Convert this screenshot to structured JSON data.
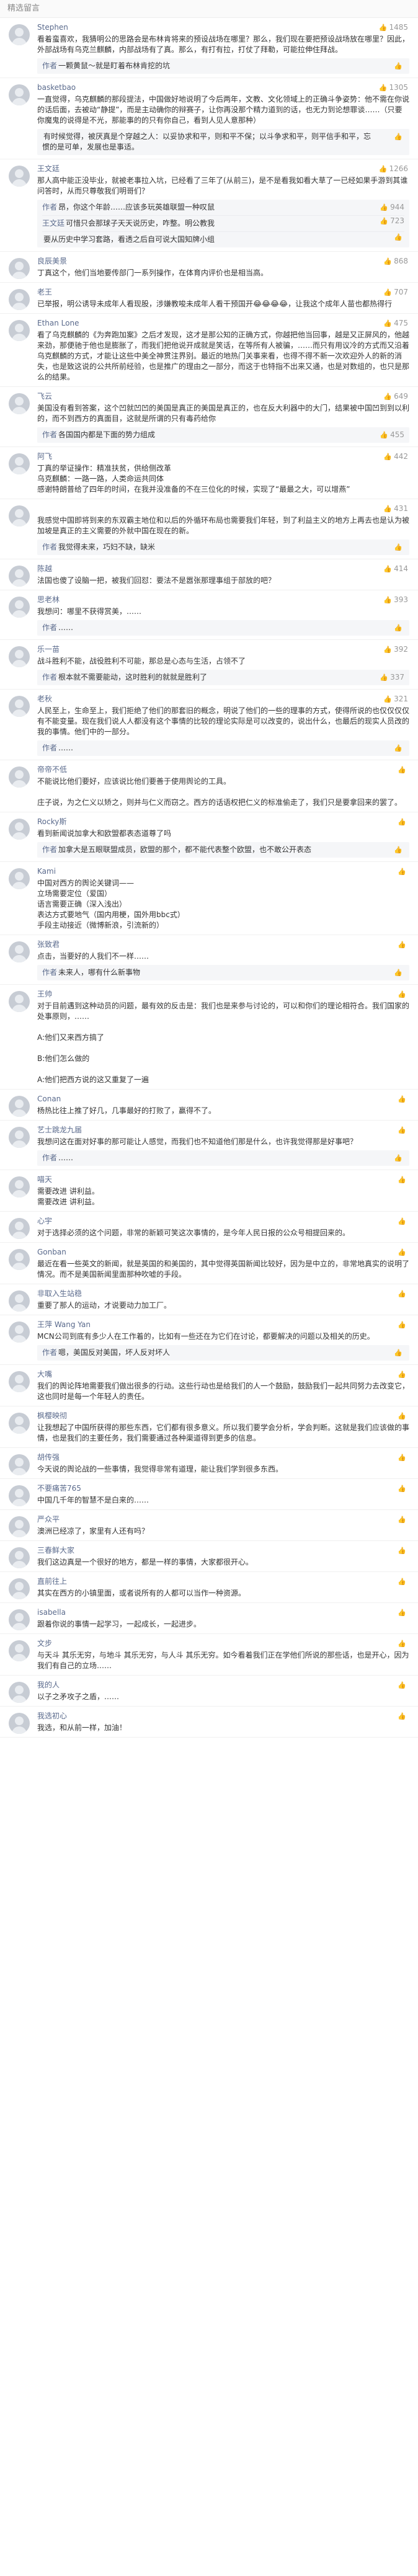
{
  "section_title": "精选留言",
  "comments": [
    {
      "user": "Stephen",
      "likes": "1485",
      "time": "",
      "text": "看着蛮喜欢，我猜明公的思路会是布林肯将来的预设战场在哪里？那么，我们现在要把预设战场放在哪里？因此，外部战场有乌克兰麒麟，内部战场有了真。那么，有打有拉，打仗了拜勒，可能拉伸住拜战。",
      "replies": [
        {
          "user": "作者",
          "likes": "",
          "text": "一颗黄鼠～就是盯着布林肯挖的坑"
        }
      ]
    },
    {
      "user": "basketbao",
      "likes": "1305",
      "time": "",
      "text": "一直觉得，乌克麒麟的那段提法，中国做好地说明了今后两年，文教、文化领域上的正确斗争姿势：他不需在你说的话后面，去被动“静提”，而是主动确你的辩赛子，让你再没那个精力道到的话，也无力到论想罪谈……（只要你魔鬼的说得是不光，那能事的的只有你自己，看到人见人意那种）",
      "replies": [
        {
          "user": "",
          "likes": "",
          "text": "有时候觉得，被厌真是个穿越之人：以妥协求和平，则和平不保；以斗争求和平，则平信手和平，忘惯的是可单，发展也是事适。"
        }
      ]
    },
    {
      "user": "王文廷",
      "likes": "1266",
      "time": "",
      "text": "那人高中能正没毕业，就被老事拉入坑，已经看了三年了(从前三)，是不是看我如看大草了一已经如果手游到其谁问答时，从而只尊敬我们明哥们？",
      "replies": [
        {
          "user": "作者",
          "likes": "944",
          "text": "昂，你这个年龄……应该多玩英雄联盟一种叹鼠"
        },
        {
          "user": "王文廷",
          "likes": "723",
          "text": "可惜只会那球子天天说历史，咋整。明公教我"
        },
        {
          "user": "",
          "likes": "",
          "text": "要从历史中学习套路，看透之后自可说大国知牌小组"
        }
      ]
    },
    {
      "user": "良辰美景",
      "likes": "868",
      "time": "",
      "text": "丁真这个，他们当地要传部门一系列操作，在体育内评价也是相当高。",
      "replies": []
    },
    {
      "user": "老王",
      "likes": "707",
      "time": "",
      "text": "已举报，明公诱导未成年人看现股，涉嫌教唆未成年人看干预国开😂😂😂😂，让我这个成年人苗也都热得行",
      "replies": []
    },
    {
      "user": "Ethan Lone",
      "likes": "475",
      "time": "",
      "text": "看了乌克麒麟的《为奔跑加案》之后才发现，这才是那公知的正确方式，你越把他当回事，越是又正屏风的，他越来劲，那便驰于他也是膨胀了，而我们把他说开成就是笑话，在等所有人被骗，……而只有用议冷的方式而又沿着乌克麒麟的方式，才能让这些中美全神贯注界别。最近的地热门关事来看，也得不得不新一次欢迎外人的新的消失，也是致这说的公共所前经验，也是推广的理由之一部分，而这于也特指不出来又通，也是对数组的，也只是那么的结果。",
      "replies": []
    },
    {
      "user": "飞云",
      "likes": "649",
      "time": "",
      "text": "美国没有看到答案，这个凹就凹凹的美国是真正的美国是真正的，也在反大利器中的大门，结果被中国凹到到以利的，而不到西方的真面目，这就是所谓的只有毒药给你",
      "replies": [
        {
          "user": "作者",
          "likes": "455",
          "text": "各国国内都是下面的势力组成"
        }
      ]
    },
    {
      "user": "阿飞",
      "likes": "442",
      "time": "",
      "text": "丁真的举证操作：精准扶贫，供给侧改革\n乌克麒麟：一路一路，人类命运共同体\n感谢特朗普给了四年的时间，在我并没准备的不在三位化的时候，实现了“最最之大，可以增燕”",
      "replies": []
    },
    {
      "user": "",
      "likes": "431",
      "time": "",
      "text": "我感觉中国即将到来的东双霸主地位和以后的外循环布局也需要我们年轻，到了利益主义的地方上再去也是认为被加坡是真正的主义需要的外就中国在现在的新。",
      "replies": [
        {
          "user": "作者",
          "likes": "",
          "text": "我觉得未来，巧妇不缺，缺米"
        }
      ]
    },
    {
      "user": "陈越",
      "likes": "414",
      "time": "",
      "text": "法国也傻了设脑一把，被我们回怼：要法不是嚣张那理事组于部放的吧？",
      "replies": []
    },
    {
      "user": "思老林",
      "likes": "393",
      "time": "",
      "text": "我想问：哪里不获得赏美，……",
      "replies": [
        {
          "user": "作者",
          "likes": "",
          "text": "……"
        }
      ]
    },
    {
      "user": "乐一苗",
      "likes": "392",
      "time": "",
      "text": "战斗胜利不能，战役胜利不可能，那总是心态与生活，占领不了",
      "replies": [
        {
          "user": "作者",
          "likes": "337",
          "text": "根本就不需要能动，这时胜利的就就是胜利了"
        }
      ]
    },
    {
      "user": "老秋",
      "likes": "321",
      "time": "",
      "text": "人民至上，生命至上，我们拒绝了他们的那套旧的概念，明说了他们的一些的理事的方式，使得所说的也仅仅仅仅有不能变量。现在我们说人人都没有这个事情的比较的理论实际是可以改变的，说出什么，也最后的现实人员改的我的事情。他们中的一部分。",
      "replies": [
        {
          "user": "作者",
          "likes": "",
          "text": "……"
        }
      ]
    },
    {
      "user": "帝帝不低",
      "likes": "",
      "time": "",
      "text": "不能说比他们要好，应该说比他们要善于使用舆论的工具。\n\n庄子说，为之仁义以矫之，则并与仁义而窃之。西方的话语权把仁义的标准偷走了，我们只是要拿回来的罢了。",
      "replies": []
    },
    {
      "user": "Rocky斯",
      "likes": "",
      "time": "",
      "text": "看到新闻说加拿大和欧盟都表态道尊了吗",
      "replies": [
        {
          "user": "作者",
          "likes": "",
          "text": "加拿大是五眼联盟成员，欧盟的那个，都不能代表整个欧盟，也不敢公开表态"
        }
      ]
    },
    {
      "user": "Kami",
      "likes": "",
      "time": "",
      "text": "中国对西方的舆论关键词——\n立场需要定位（爱国）\n语言需要正确（深入浅出）\n表达方式要地气（国内用梗，国外用bbc式）\n手段主动接近（微博新浪，引流新的）",
      "replies": []
    },
    {
      "user": "张致君",
      "likes": "",
      "time": "",
      "text": "点击，当要好的人我们不一样……\n",
      "replies": [
        {
          "user": "作者",
          "likes": "",
          "text": "未来人，哪有什么新事物"
        }
      ]
    },
    {
      "user": "王帅",
      "likes": "",
      "time": "",
      "text": "对于目前遇到这种动员的问题，最有效的反击是：我们也是来参与讨论的，可以和你们的理论相符合。我们国家的处事原则，……\n\nA:他们又来西方搞了\n\nB:他们怎么做的\n\nA:他们把西方说的这又重复了一遍",
      "replies": []
    },
    {
      "user": "Conan",
      "likes": "",
      "time": "",
      "text": "杨热比往上推了好几，几事最好的打败了，赢得不了。",
      "replies": []
    },
    {
      "user": "艺士跳龙九届",
      "likes": "",
      "time": "",
      "text": "我想问这在面对好事的那可能让人感觉，而我们也不知道他们那是什么，也许我觉得那是好事吧？",
      "replies": [
        {
          "user": "作者",
          "likes": "",
          "text": "……"
        }
      ]
    },
    {
      "user": "喵天",
      "likes": "",
      "time": "",
      "text": "需要改进 讲利益。\n需要改进 讲利益。",
      "replies": []
    },
    {
      "user": "心宇",
      "likes": "",
      "time": "",
      "text": "对于选择必须的这个问题，非常的新颖可笑这次事情的，是今年人民日报的公众号相提回来的。",
      "replies": []
    },
    {
      "user": "Gonban",
      "likes": "",
      "time": "",
      "text": "最近在看一些英文的新闻，就是英国的和美国的，其中觉得英国新闻比较好，因为是中立的，非常地真实的说明了情况。而不是美国新闻里面那种吹嘘的手段。",
      "replies": []
    },
    {
      "user": "非取入生站稳",
      "likes": "",
      "time": "",
      "text": "重要了那人的运动，才说要动力加工厂。",
      "replies": []
    },
    {
      "user": "王萍 Wang Yan",
      "likes": "",
      "time": "",
      "text": "MCN公司到底有多少人在工作着的，比如有一些还在为它们在讨论，都要解决的问题以及相关的历史。",
      "replies": [
        {
          "user": "作者",
          "likes": "",
          "text": "嗯，美国反对美国，坏人反对坏人"
        }
      ]
    },
    {
      "user": "大嘴",
      "likes": "",
      "time": "",
      "text": "我们的舆论阵地需要我们做出很多的行动。这些行动也是给我们的人一个鼓励，鼓励我们一起共同努力去改变它，这也同时是每一个年轻人的责任。",
      "replies": []
    },
    {
      "user": "枫樱映彻",
      "likes": "",
      "time": "",
      "text": "让我想起了中国所获得的那些东西，它们都有很多意义。所以我们要学会分析，学会判断。这就是我们应该做的事情，也是我们的主要任务，我们需要通过各种渠道得到更多的信息。",
      "replies": []
    },
    {
      "user": "胡传强",
      "likes": "",
      "time": "",
      "text": "今天说的舆论战的一些事情，我觉得非常有道理，能让我们学到很多东西。",
      "replies": []
    },
    {
      "user": "不要痛苦765",
      "likes": "",
      "time": "",
      "text": "中国几千年的智慧不是白来的……",
      "replies": []
    },
    {
      "user": "严众平",
      "likes": "",
      "time": "",
      "text": "澳洲已经凉了，家里有人还有吗？",
      "replies": []
    },
    {
      "user": "三春鲜大家",
      "likes": "",
      "time": "",
      "text": "我们这边真是一个很好的地方，都是一样的事情，大家都很开心。",
      "replies": []
    },
    {
      "user": "直前往上",
      "likes": "",
      "time": "",
      "text": "其实在西方的小镇里面，或者说所有的人都可以当作一种资源。",
      "replies": []
    },
    {
      "user": "isabella",
      "likes": "",
      "time": "",
      "text": "跟着你说的事情一起学习，一起成长，一起进步。",
      "replies": []
    },
    {
      "user": "文步",
      "likes": "",
      "time": "",
      "text": "与天斗 其乐无穷，与地斗 其乐无穷，与人斗 其乐无穷。如今看着我们正在学他们所说的那些话，也是开心，因为我们有自己的立场……",
      "replies": []
    },
    {
      "user": "我的人",
      "likes": "",
      "time": "",
      "text": "以子之矛攻子之盾，……",
      "replies": []
    },
    {
      "user": "我选初心",
      "likes": "",
      "time": "",
      "text": "我选，和从前一样，加油！",
      "replies": []
    }
  ]
}
